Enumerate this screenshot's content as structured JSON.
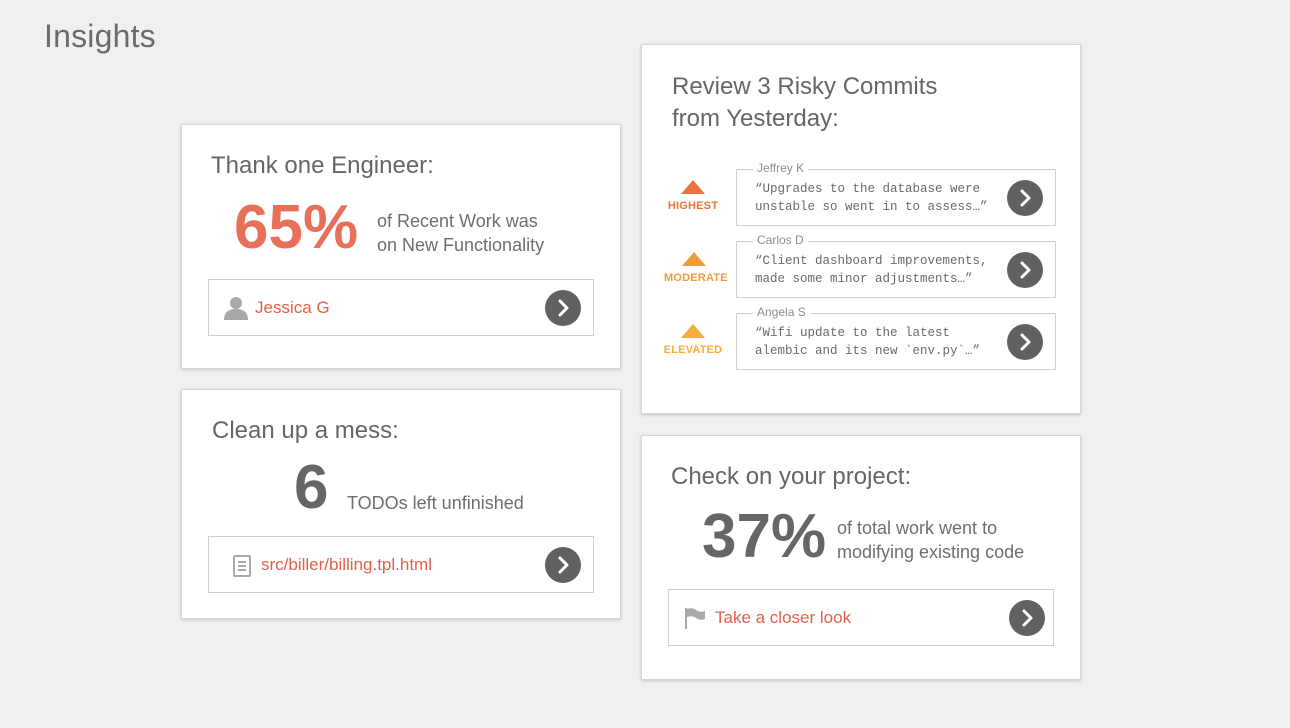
{
  "page": {
    "title": "Insights"
  },
  "thank_card": {
    "title": "Thank one Engineer:",
    "stat": "65%",
    "description_line1": "of Recent Work was",
    "description_line2": "on New Functionality",
    "link_label": "Jessica G",
    "link_icon": "person-icon",
    "stat_color": "#e8705a"
  },
  "mess_card": {
    "title": "Clean up a mess:",
    "stat": "6",
    "description": "TODOs left unfinished",
    "link_label": "src/biller/billing.tpl.html",
    "link_icon": "document-icon"
  },
  "commits_card": {
    "title_line1": "Review 3 Risky Commits",
    "title_line2": "from Yesterday:",
    "commits": [
      {
        "risk": "HIGHEST",
        "risk_color": "#e8733c",
        "author": "Jeffrey K",
        "message_line1": "“Upgrades to the database were",
        "message_line2": "unstable so went in to assess…”"
      },
      {
        "risk": "MODERATE",
        "risk_color": "#f29a3a",
        "author": "Carlos D",
        "message_line1": "“Client dashboard improvements,",
        "message_line2": "made some minor adjustments…”"
      },
      {
        "risk": "ELEVATED",
        "risk_color": "#f5ad3c",
        "author": "Angela S",
        "message_line1": "“Wifi update to the latest",
        "message_line2": "alembic and its new `env.py`…”"
      }
    ]
  },
  "project_card": {
    "title": "Check on your project:",
    "stat": "37%",
    "description_line1": "of total work went to",
    "description_line2": "modifying existing code",
    "link_label": "Take a closer look",
    "link_icon": "flag-icon"
  },
  "colors": {
    "accent": "#e4604a",
    "button": "#616161",
    "background": "#f1f0ee"
  }
}
